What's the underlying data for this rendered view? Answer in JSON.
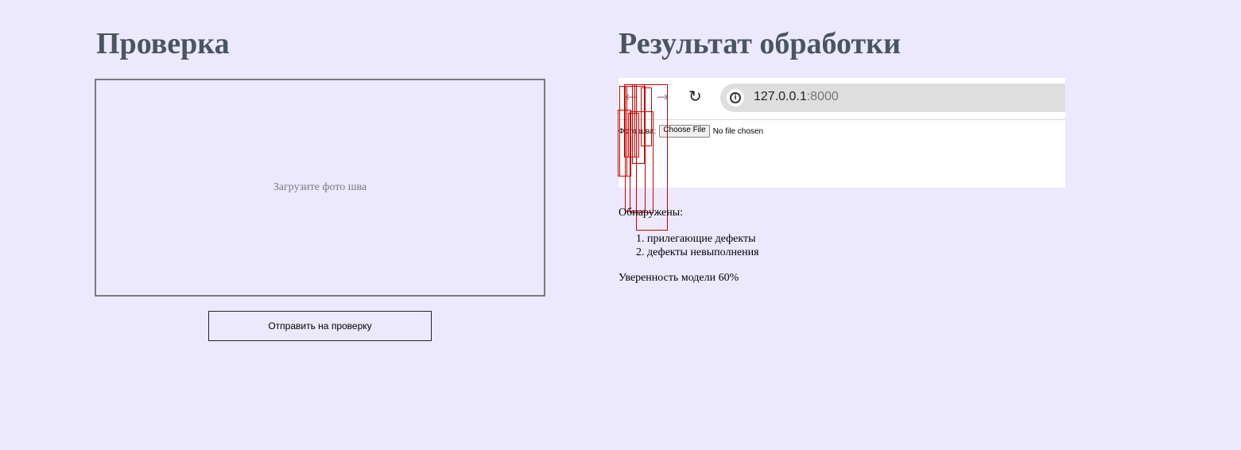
{
  "left_panel": {
    "title": "Проверка",
    "dropzone_text": "Загрузите фото шва",
    "submit_label": "Отправить на проверку"
  },
  "right_panel": {
    "title": "Результат обработки",
    "result_image": {
      "url_host": "127.0.0.1",
      "url_port": ":8000",
      "file_label": "Фото шва:",
      "choose_file_label": "Choose File",
      "no_file_text": "No file chosen",
      "bbox_color": "#cc0000"
    },
    "detected_label": "Обнаружены:",
    "defects": [
      "1. прилегающие дефекты",
      "2. дефекты невыполнения"
    ],
    "confidence_text": "Уверенность модели 60%"
  },
  "colors": {
    "background": "#ece9fe",
    "heading": "#4a5560"
  }
}
